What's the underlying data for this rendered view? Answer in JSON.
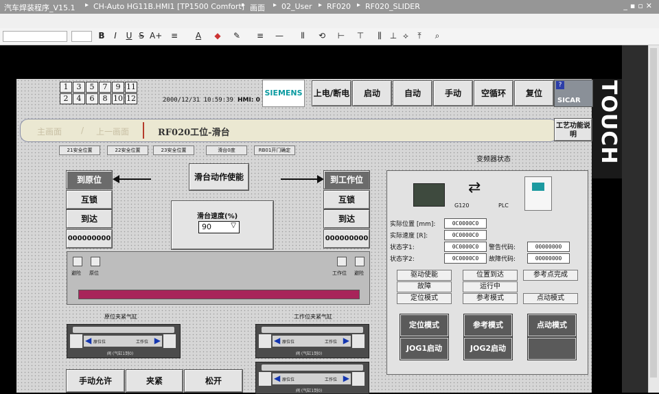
{
  "breadcrumb": [
    "汽车焊装程序_V15.1",
    "CH-Auto HG11B.HMI1 [TP1500 Comfort]",
    "画面",
    "02_User",
    "RF020",
    "RF020_SLIDER"
  ],
  "window_controls": "_▪▫✕",
  "toolbar": {
    "bold": "B",
    "italic": "I",
    "underline": "U",
    "strike": "S",
    "font_size_up": "A+",
    "align": "≡",
    "font_color": "A",
    "fill": "◆",
    "line_color": "✎",
    "line_style": "≡",
    "line_width": "—",
    "misc": [
      "⫴",
      "⟲",
      "⊢",
      "⊤",
      "⫼",
      "⊥",
      "⟡",
      "⤒",
      "⌕"
    ]
  },
  "touch_label": "TOUCH",
  "hmi": {
    "screen_numbers": [
      "1",
      "3",
      "5",
      "7",
      "9",
      "11",
      "2",
      "4",
      "6",
      "8",
      "10",
      "12"
    ],
    "datetime": "2000/12/31 10:59:39",
    "hmi_label": "HMI: 0",
    "logo": "SIEMENS",
    "header_buttons": [
      "上电/断电",
      "启动",
      "自动",
      "手动",
      "空循环",
      "复位"
    ],
    "brand": "SICAR",
    "nav": {
      "main": "主画面",
      "prev": "上一画面",
      "title": "RF020工位-滑台"
    },
    "process_btn": "工艺功能说明",
    "safety": [
      "21安全位置",
      "22安全位置",
      "23安全位置",
      "滑台0度",
      "RB01开门确定"
    ],
    "left_col": {
      "home": "到原位",
      "interlock": "互锁",
      "arrive": "到达",
      "count": "000000000"
    },
    "enable_btn": "滑台动作使能",
    "speed": {
      "label": "滑台速度(%)",
      "value": "90"
    },
    "right_col": {
      "work": "到工作位",
      "interlock": "互锁",
      "arrive": "到达",
      "count": "000000000"
    },
    "indicators_left": [
      "避险",
      "原位"
    ],
    "indicators_right": [
      "工作位",
      "避险"
    ],
    "valve_left_title": "原位夹紧气缸",
    "valve_right_title": "工作位夹紧气缸",
    "cyl_labels": {
      "home": "原位位",
      "work": "工作位",
      "note": "阀 (气缸1到0)"
    },
    "manual": {
      "allow": "手动允许",
      "clamp": "夹紧",
      "open": "松开"
    },
    "vfd": {
      "title": "变频器状态",
      "g120": "G120",
      "plc": "PLC",
      "actual_pos_label": "实际位置 [mm]:",
      "actual_pos": "0C0000C0",
      "actual_speed_label": "实际速度 [R]:",
      "actual_speed": "0C0000C0",
      "status1_label": "状态字1:",
      "status1": "0C0000C0",
      "status2_label": "状态字2:",
      "status2": "0C0000C0",
      "warn_label": "警告代码:",
      "warn": "00000000",
      "fault_label": "故障代码:",
      "fault": "00000000",
      "status_items": [
        "驱动使能",
        "位置到达",
        "参考点完成",
        "故障",
        "运行中",
        "定位模式",
        "参考模式",
        "点动模式"
      ],
      "buttons": [
        "定位模式",
        "参考模式",
        "点动模式",
        "JOG1启动",
        "JOG2启动",
        ""
      ]
    }
  }
}
